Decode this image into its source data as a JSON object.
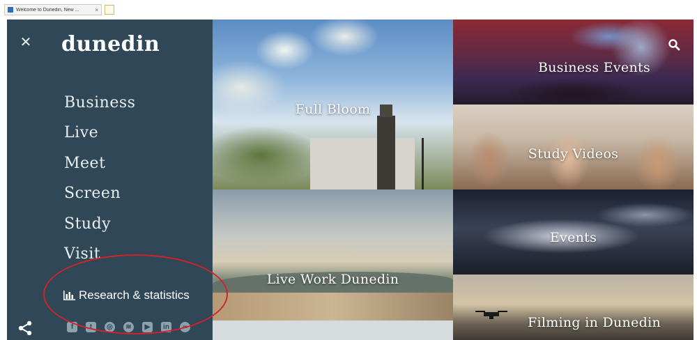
{
  "browser": {
    "tab_title": "Welcome to Dunedin, New ...",
    "tab_close": "×"
  },
  "sidebar": {
    "close_glyph": "✕",
    "logo": "dunedin",
    "nav": [
      "Business",
      "Live",
      "Meet",
      "Screen",
      "Study",
      "Visit"
    ],
    "research_label": "Research & statistics",
    "socials": [
      {
        "icon": "facebook-icon",
        "glyph": "f"
      },
      {
        "icon": "twitter-icon",
        "glyph": "t"
      },
      {
        "icon": "instagram-icon",
        "glyph": "◎"
      },
      {
        "icon": "spotify-icon",
        "glyph": "≋"
      },
      {
        "icon": "youtube-icon",
        "glyph": "▶"
      },
      {
        "icon": "linkedin-icon",
        "glyph": "in"
      },
      {
        "icon": "tripadvisor-icon",
        "glyph": "∞"
      }
    ]
  },
  "tiles": {
    "full_bloom": "Full Bloom",
    "business_events": "Business Events",
    "study_videos": "Study Videos",
    "events": "Events",
    "live_work": "Live Work Dunedin",
    "filming": "Filming in Dunedin"
  },
  "colors": {
    "sidebar_bg": "#2f4756",
    "annotation": "#d0242c"
  }
}
